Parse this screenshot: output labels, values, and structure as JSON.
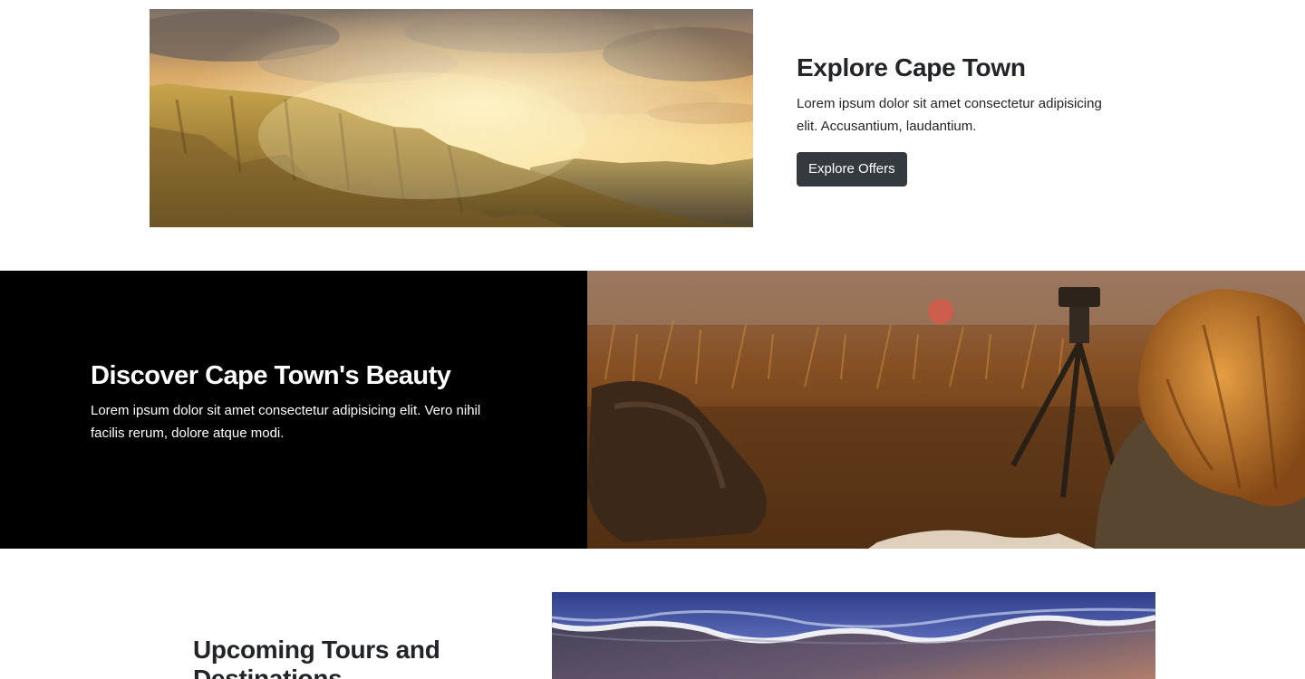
{
  "explore": {
    "title": "Explore Cape Town",
    "text": "Lorem ipsum dolor sit amet consectetur adipisicing elit. Accusantium, laudantium.",
    "button_label": "Explore Offers"
  },
  "discover": {
    "title": "Discover Cape Town's Beauty",
    "text": "Lorem ipsum dolor sit amet consectetur adipisicing elit. Vero nihil facilis rerum, dolore atque modi."
  },
  "tours": {
    "title": "Upcoming Tours and Destinations"
  },
  "colors": {
    "button_bg": "#343a40",
    "dark_section_bg": "#000000",
    "heading": "#212529"
  }
}
